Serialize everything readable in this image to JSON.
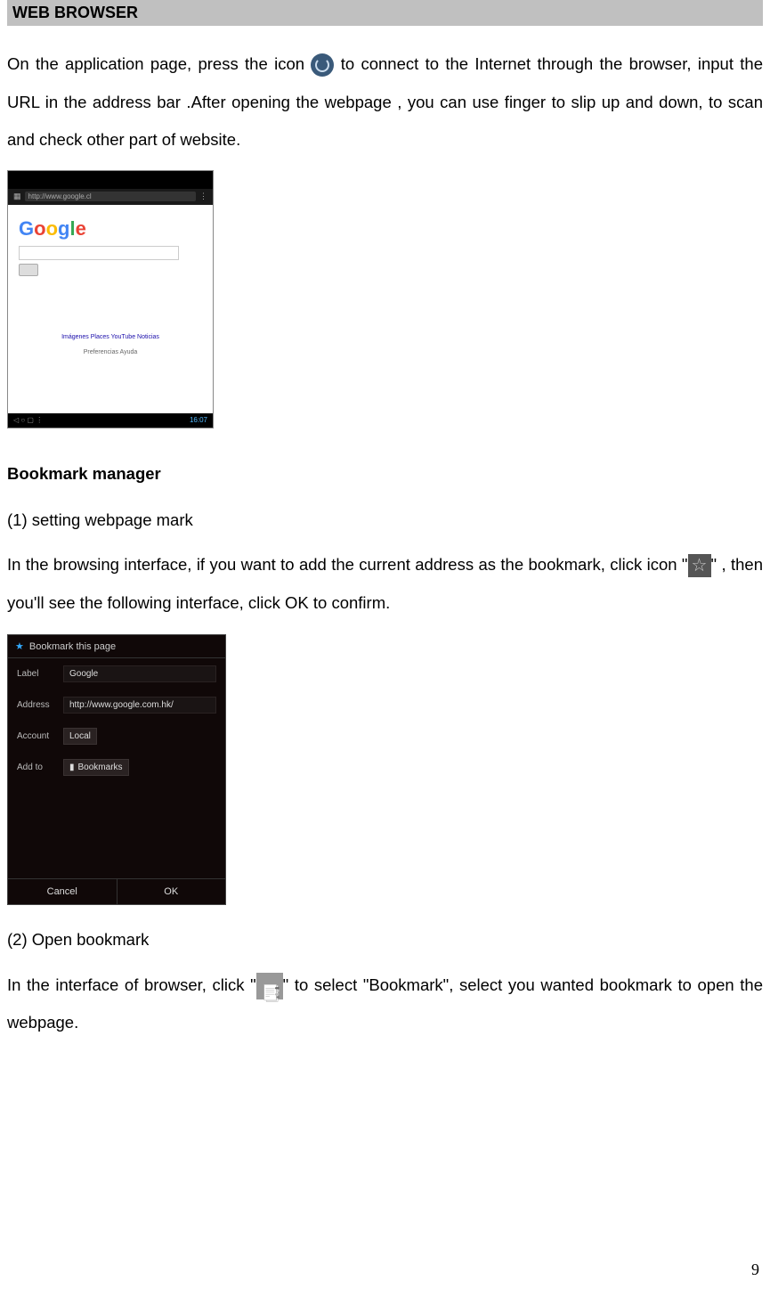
{
  "section_title": "WEB BROWSER",
  "para1a": "On the application page, press the icon ",
  "para1b": " to connect to the Internet through the browser, input the URL in the address bar .After opening the webpage , you can use finger to slip up and down, to scan and check other part of website.",
  "screenshot1": {
    "url": "http://www.google.cl",
    "time": "16:07",
    "google_search_placeholder": "",
    "links": "Imágenes   Places   YouTube   Noticias",
    "footer": "Preferencias   Ayuda"
  },
  "subheading": "Bookmark manager",
  "item1": "(1)  setting webpage mark",
  "para2a": "In the browsing interface, if you want to add the current address as the bookmark, click icon \"",
  "para2b": "\" , then you'll see the following interface, click OK to confirm.",
  "screenshot2": {
    "title": "Bookmark this page",
    "label_label": "Label",
    "label_value": "Google",
    "address_label": "Address",
    "address_value": "http://www.google.com.hk/",
    "account_label": "Account",
    "account_value": "Local",
    "addto_label": "Add to",
    "addto_value": "Bookmarks",
    "cancel": "Cancel",
    "ok": "OK"
  },
  "item2": "(2)  Open bookmark",
  "para3a": "In the interface of browser, click \"",
  "para3b": "\" to select \"Bookmark\", select you wanted bookmark to open the webpage.",
  "page_number": "9"
}
